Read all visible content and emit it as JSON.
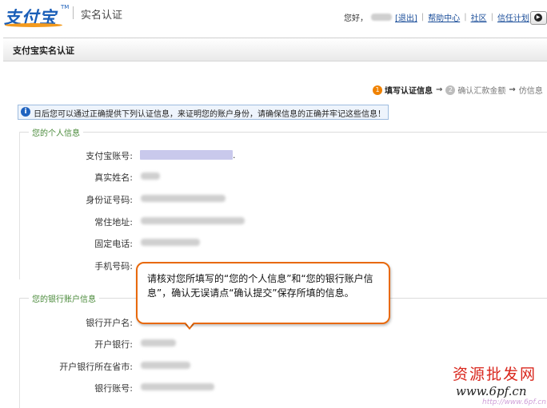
{
  "header": {
    "logo_text": "支付宝",
    "logo_tm": "TM",
    "title": "实名认证",
    "nav": {
      "greeting": "您好，",
      "logout": "[退出]",
      "help": "帮助中心",
      "community": "社区",
      "trust_plan": "信任计划"
    },
    "play_icon": "play-circle-icon"
  },
  "page_title": "支付宝实名认证",
  "steps": [
    {
      "num": "1",
      "label": "填写认证信息",
      "active": true
    },
    {
      "num": "2",
      "label": "确认汇款金额",
      "active": false
    },
    {
      "num": "",
      "label": "仿信息",
      "active": false
    }
  ],
  "notice": "日后您可以通过正确提供下列认证信息，来证明您的账户身份，请确保信息的正确并牢记这些信息！",
  "personal": {
    "legend": "您的个人信息",
    "fields": [
      {
        "label": "支付宝账号:"
      },
      {
        "label": "真实姓名:"
      },
      {
        "label": "身份证号码:"
      },
      {
        "label": "常住地址:"
      },
      {
        "label": "固定电话:"
      },
      {
        "label": "手机号码:"
      }
    ],
    "account_suffix": "."
  },
  "bank": {
    "legend": "您的银行账户信息",
    "fields": [
      {
        "label": "银行开户名:"
      },
      {
        "label": "开户银行:"
      },
      {
        "label": "开户银行所在省市:"
      },
      {
        "label": "银行账号:"
      }
    ]
  },
  "tooltip": "请核对您所填写的“您的个人信息”和“您的银行账户信息”，确认无误请点“确认提交”保存所填的信息。",
  "watermark": {
    "line1": "资源批发网",
    "line2": "www.6pf.cn",
    "line3": "http://www.6pf.cn"
  },
  "colors": {
    "brand_blue": "#1a5eb8",
    "brand_orange": "#f39a1e",
    "step_active": "#f08200",
    "tooltip_border": "#e8690c",
    "legend_green": "#4a8a3a"
  }
}
